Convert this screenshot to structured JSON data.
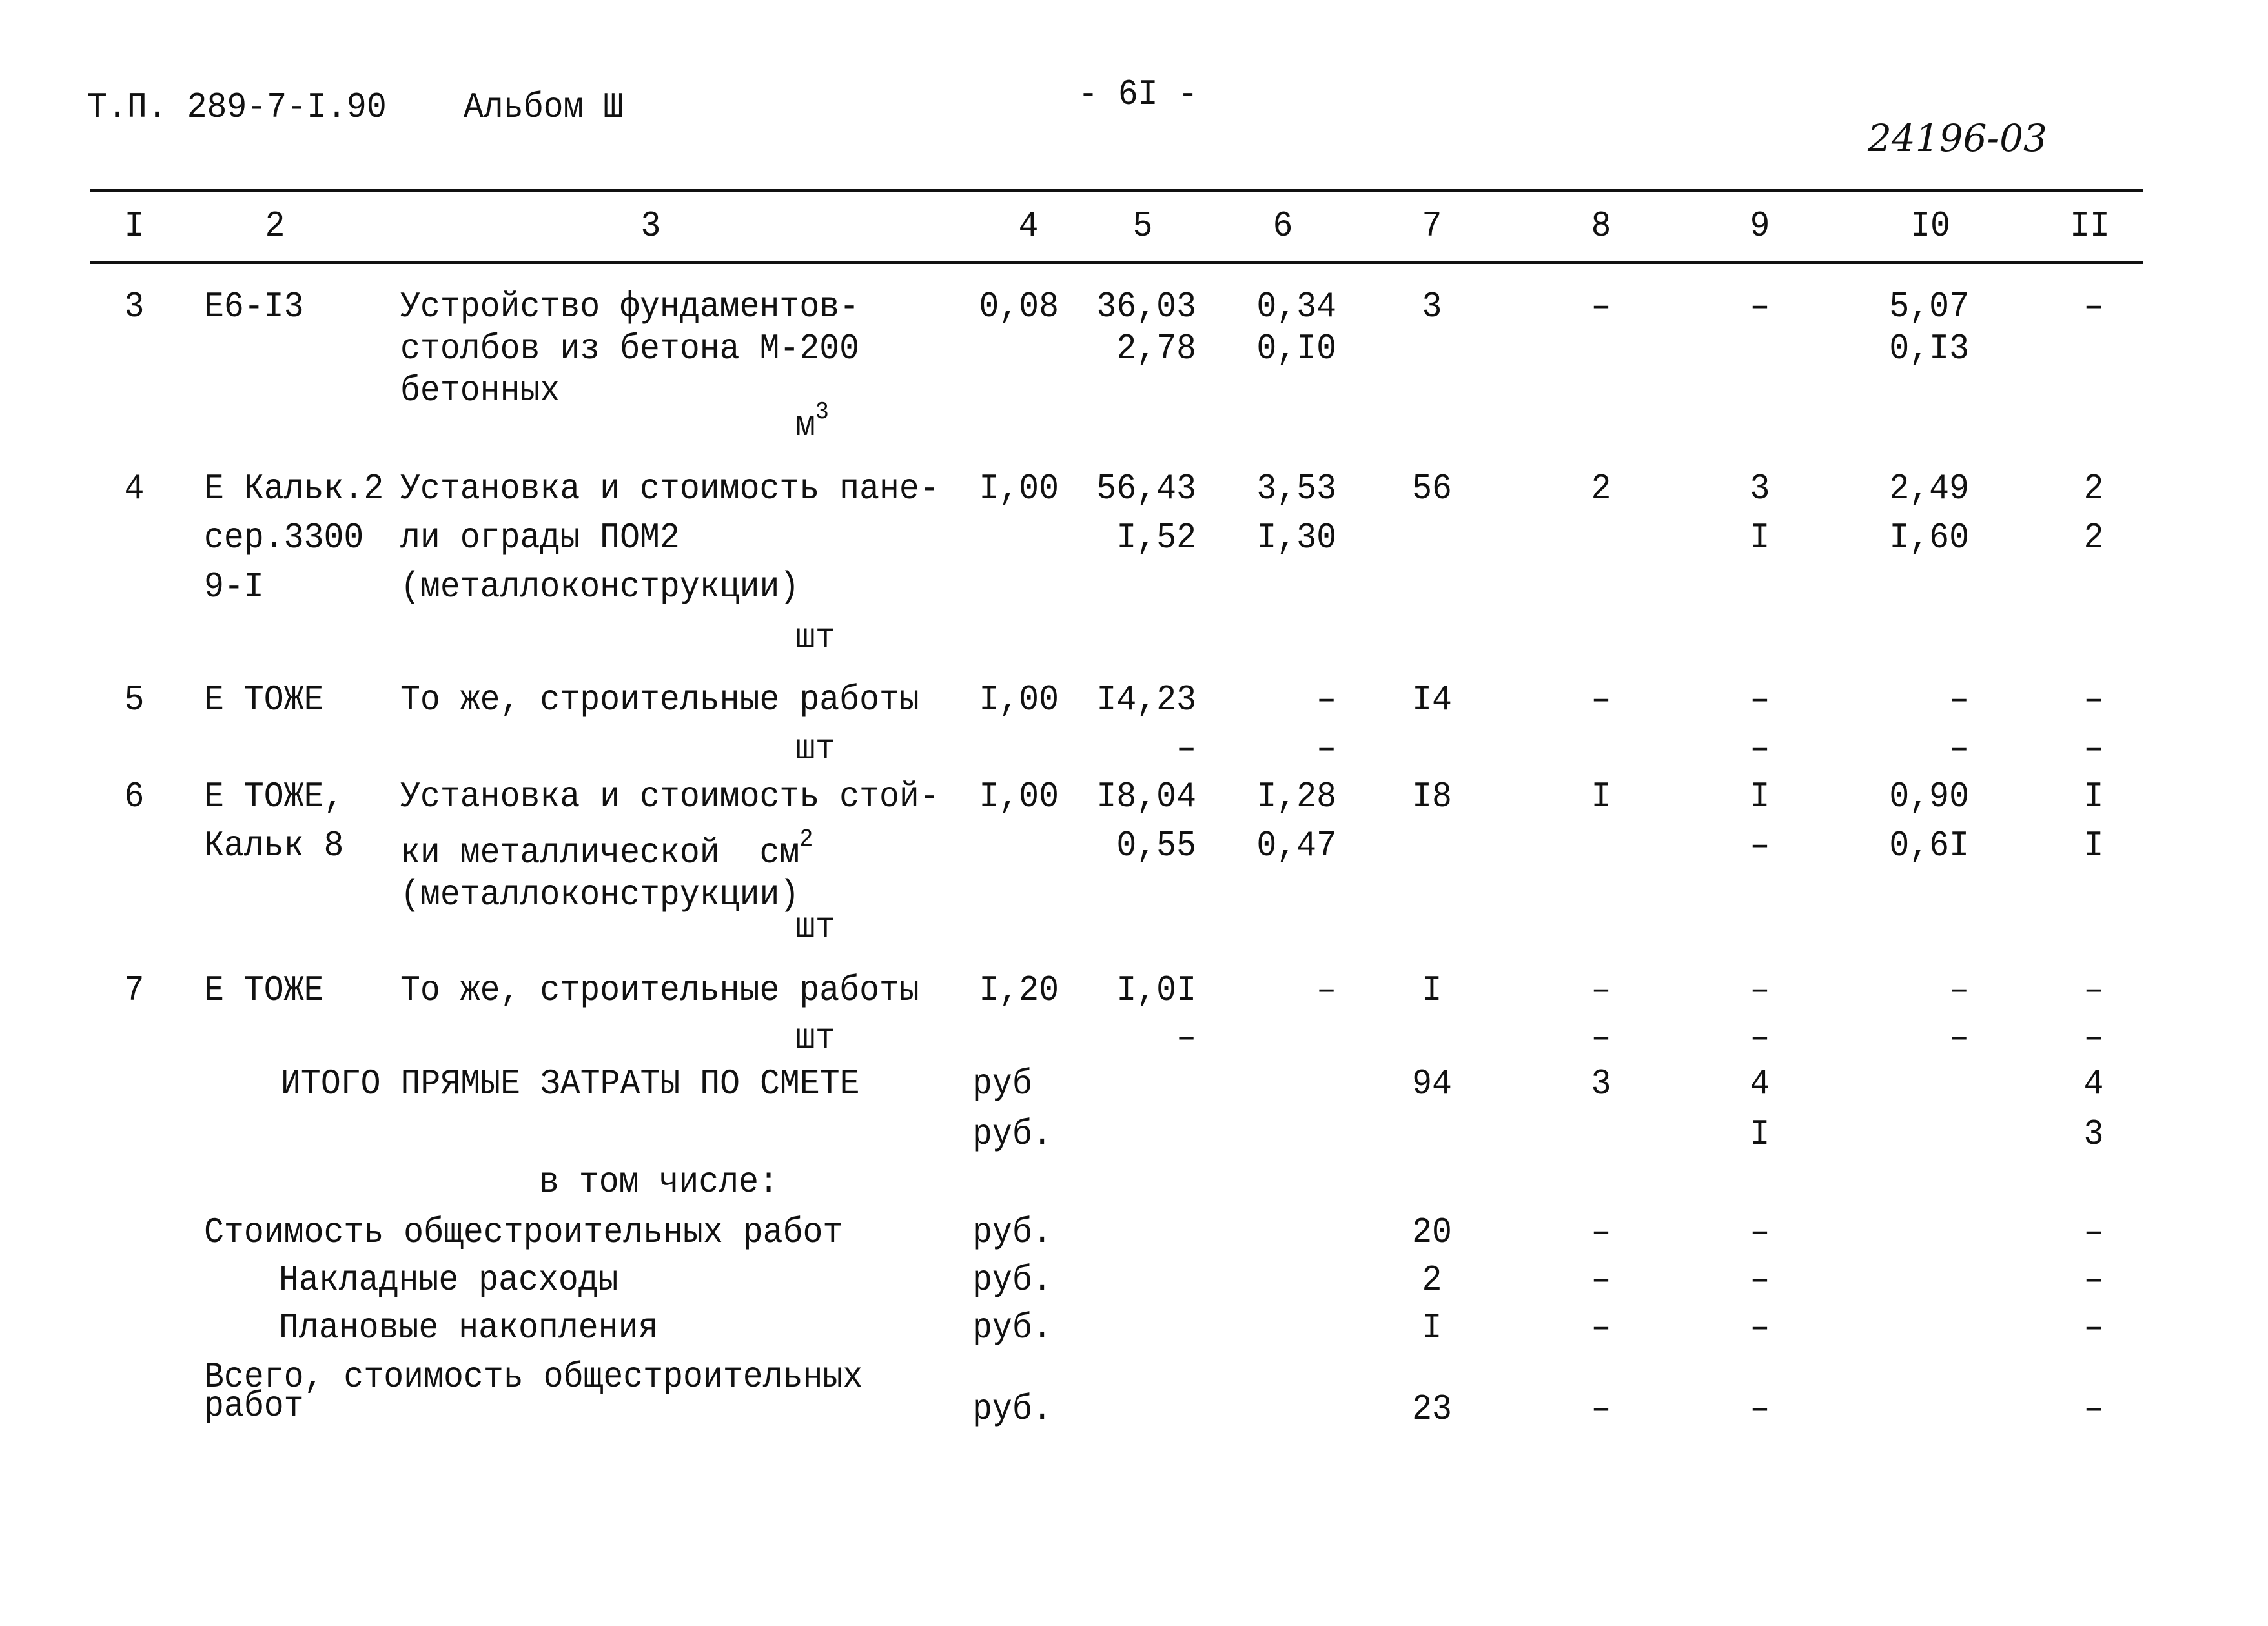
{
  "header": {
    "doc_code": "Т.П. 289-7-I.90",
    "album": "Альбом Ш",
    "page_number": "- 6I -",
    "handwritten_code": "24196-03"
  },
  "columns": [
    "I",
    "2",
    "3",
    "4",
    "5",
    "6",
    "7",
    "8",
    "9",
    "I0",
    "II"
  ],
  "rows": [
    {
      "num": "3",
      "code": [
        "Е6-I3"
      ],
      "desc": [
        "Устройство фундаментов-",
        "столбов из бетона М-200",
        "бетонных"
      ],
      "unit": "м",
      "unit_sup": "3",
      "c4": "0,08",
      "c5": [
        "36,03",
        "2,78"
      ],
      "c6": [
        "0,34",
        "0,I0"
      ],
      "c7": [
        "3"
      ],
      "c8": [
        "–"
      ],
      "c9": [
        "–"
      ],
      "c10": [
        "5,07",
        "0,I3"
      ],
      "c11": [
        "–"
      ]
    },
    {
      "num": "4",
      "code": [
        "Е Кальк.2",
        "сер.3300",
        "9-I"
      ],
      "desc": [
        "Установка и стоимость пане-",
        "ли ограды ПОМ2",
        "(металлоконструкции)"
      ],
      "unit": "шт",
      "c4": "I,00",
      "c5": [
        "56,43",
        "I,52"
      ],
      "c6": [
        "3,53",
        "I,30"
      ],
      "c7": [
        "56"
      ],
      "c8": [
        "2"
      ],
      "c9": [
        "3",
        "I"
      ],
      "c10": [
        "2,49",
        "I,60"
      ],
      "c11": [
        "2",
        "2"
      ]
    },
    {
      "num": "5",
      "code": [
        "Е ТОЖЕ"
      ],
      "desc": [
        "То же, строительные работы"
      ],
      "unit": "шт",
      "c4": "I,00",
      "c5": [
        "I4,23",
        "–"
      ],
      "c6": [
        "–",
        "–"
      ],
      "c7": [
        "I4"
      ],
      "c8": [
        "–"
      ],
      "c9": [
        "–",
        "–"
      ],
      "c10": [
        "–",
        "–"
      ],
      "c11": [
        "–",
        "–"
      ]
    },
    {
      "num": "6",
      "code": [
        "Е ТОЖЕ,",
        "Кальк 8"
      ],
      "desc": [
        "Установка и стоимость стой-",
        "ки металлической  см",
        "(металлоконструкции)"
      ],
      "desc_sup": "2",
      "unit": "шт",
      "c4": "I,00",
      "c5": [
        "I8,04",
        "0,55"
      ],
      "c6": [
        "I,28",
        "0,47"
      ],
      "c7": [
        "I8"
      ],
      "c8": [
        "I"
      ],
      "c9": [
        "I",
        "–"
      ],
      "c10": [
        "0,90",
        "0,6I"
      ],
      "c11": [
        "I",
        "I"
      ]
    },
    {
      "num": "7",
      "code": [
        "Е ТОЖЕ"
      ],
      "desc": [
        "То же, строительные работы"
      ],
      "unit": "шт",
      "c4": "I,20",
      "c5": [
        "I,0I",
        "–"
      ],
      "c6": [
        "–"
      ],
      "c7": [
        "I"
      ],
      "c8": [
        "–",
        "–"
      ],
      "c9": [
        "–",
        "–"
      ],
      "c10": [
        "–",
        "–"
      ],
      "c11": [
        "–",
        "–"
      ]
    }
  ],
  "totals": {
    "label": "ИТОГО ПРЯМЫЕ ЗАТРАТЫ ПО СМЕТЕ",
    "unit1": "руб",
    "unit2": "руб.",
    "c7": "94",
    "c8": "3",
    "c9": [
      "4",
      "I"
    ],
    "c11": [
      "4",
      "3"
    ]
  },
  "including_label": "в том числе:",
  "summary": [
    {
      "label": "Стоимость общестроительных работ",
      "unit": "руб.",
      "c7": "20",
      "c8": "–",
      "c9": "–",
      "c11": "–"
    },
    {
      "label": "Накладные расходы",
      "unit": "руб.",
      "c7": "2",
      "c8": "–",
      "c9": "–",
      "c11": "–"
    },
    {
      "label": "Плановые накопления",
      "unit": "руб.",
      "c7": "I",
      "c8": "–",
      "c9": "–",
      "c11": "–"
    }
  ],
  "grand_total": {
    "label_line1": "Всего, стоимость общестроительных",
    "label_line2": "работ",
    "unit": "руб.",
    "c7": "23",
    "c8": "–",
    "c9": "–",
    "c11": "–"
  }
}
